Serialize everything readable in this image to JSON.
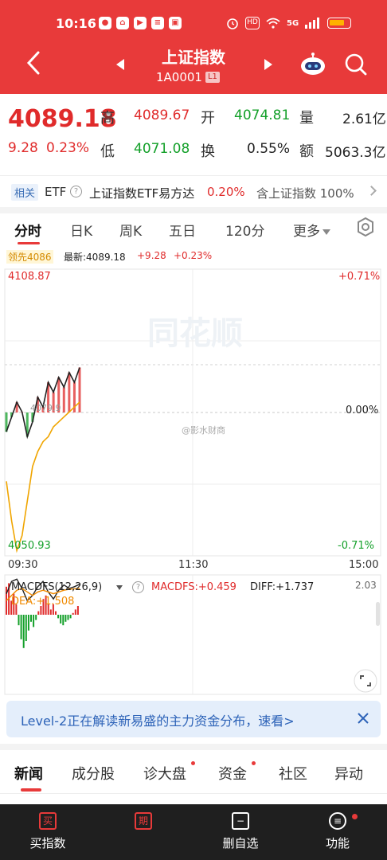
{
  "status": {
    "time": "10:16",
    "apps": [
      "●",
      "⌂",
      "▶",
      "≡",
      "▣"
    ],
    "hd": "HD",
    "signal": "5G"
  },
  "nav": {
    "title": "上证指数",
    "code": "1A0001",
    "level_badge": "L1"
  },
  "quote": {
    "price": "4089.18",
    "change": "9.28",
    "change_pct": "0.23%",
    "labels": {
      "high": "高",
      "open": "开",
      "volume": "量",
      "low": "低",
      "turnover": "换",
      "amount": "额"
    },
    "high": "4089.67",
    "open": "4074.81",
    "volume": "2.61亿",
    "low": "4071.08",
    "turnover": "0.55%",
    "amount": "5063.3亿"
  },
  "etf": {
    "tag": "相关",
    "label": "ETF",
    "help": "?",
    "name": "上证指数ETF易方达",
    "pct": "0.20%",
    "includes": "含上证指数 100%"
  },
  "chart_tabs": [
    "分时",
    "日K",
    "周K",
    "五日",
    "120分",
    "更多"
  ],
  "info": {
    "lead": "领先4086",
    "latest": "最新:4089.18",
    "chg": "+9.28",
    "pct": "+0.23%"
  },
  "chart": {
    "top_price": "4108.87",
    "bottom_price": "4050.93",
    "top_pct": "+0.71%",
    "mid_pct": "0.00%",
    "bottom_pct": "-0.71%",
    "prev_close_label": "4079.9",
    "watermark": "同花顺",
    "weibo_mark": "@影水财商",
    "times": [
      "09:30",
      "11:30",
      "15:00"
    ]
  },
  "macd": {
    "name": "MACDFS(12,26,9)",
    "value": "MACDFS:+0.459",
    "diff": "DIFF:+1.737",
    "dea": "DEA:+1.508",
    "scale_top": "2.03"
  },
  "banner": {
    "text": "Level-2正在解读新易盛的主力资金分布，速看>"
  },
  "news_tabs": [
    "新闻",
    "成分股",
    "诊大盘",
    "资金",
    "社区",
    "异动"
  ],
  "bottom_bar": [
    {
      "icon": "买",
      "label": "买指数"
    },
    {
      "icon": "期",
      "label": ""
    },
    {
      "icon": "−",
      "label": "删自选"
    },
    {
      "icon": "≡",
      "label": "功能"
    }
  ],
  "chart_data": {
    "type": "line",
    "x_range": [
      "09:30",
      "15:00"
    ],
    "y_range": [
      4050.93,
      4108.87
    ],
    "prev_close": 4079.9,
    "series": [
      {
        "values": [
          4076,
          4079,
          4082,
          4080,
          4075,
          4078,
          4083,
          4081,
          4086,
          4084,
          4087,
          4085,
          4088,
          4086,
          4089
        ]
      },
      {
        "values": [
          4066,
          4058,
          4052,
          4055,
          4062,
          4069,
          4072,
          4074,
          4075,
          4077,
          4078,
          4079,
          4080,
          4081,
          4082
        ]
      }
    ],
    "macd": {
      "hist": [
        1.6,
        1.8,
        0.8,
        1.2,
        0.6,
        -0.6,
        -1.4,
        -1.9,
        -1.5,
        -0.9,
        -0.4,
        -0.7,
        -0.3,
        0.2,
        0.5,
        0.9,
        1.1,
        0.6,
        0.3,
        0.6,
        0.2,
        -0.2,
        -0.5,
        -0.6,
        -0.4,
        -0.3,
        -0.2,
        0.1,
        0.3,
        0.5
      ],
      "diff": [
        1.2,
        1.9,
        2.03,
        1.5,
        0.8,
        1.1,
        1.6,
        1.9,
        1.3,
        0.9,
        1.4,
        1.7,
        1.5,
        1.6,
        1.737
      ],
      "dea": [
        0.8,
        1.1,
        1.4,
        1.5,
        1.3,
        1.1,
        1.3,
        1.4,
        1.3,
        1.2,
        1.3,
        1.4,
        1.45,
        1.48,
        1.508
      ]
    }
  }
}
